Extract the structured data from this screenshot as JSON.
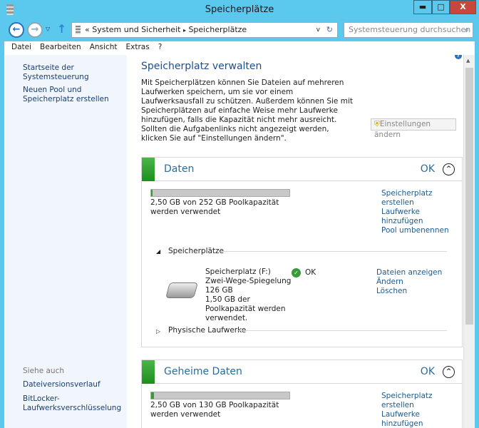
{
  "window": {
    "title": "Speicherplätze",
    "min": "▬",
    "max": "□",
    "close": "X"
  },
  "nav": {
    "back": "←",
    "forward": "→",
    "up": "↑",
    "breadcrumb_prefix": "«",
    "crumbs": [
      "System und Sicherheit",
      "Speicherplätze"
    ],
    "sep": "▸",
    "search_placeholder": "Systemsteuerung durchsuchen"
  },
  "menu": [
    "Datei",
    "Bearbeiten",
    "Ansicht",
    "Extras",
    "?"
  ],
  "sidebar": {
    "links": [
      "Startseite der Systemsteuerung",
      "Neuen Pool und Speicherplatz erstellen"
    ],
    "see_also": "Siehe auch",
    "see_links": [
      "Dateiversionsverlauf",
      "BitLocker-Laufwerksverschlüsselung"
    ]
  },
  "main": {
    "heading": "Speicherplatz verwalten",
    "intro": "Mit Speicherplätzen können Sie Dateien auf mehreren Laufwerken speichern, um sie vor einem Laufwerksausfall zu schützen. Außerdem können Sie mit Speicherplätzen auf einfache Weise mehr Laufwerke hinzufügen, falls die Kapazität nicht mehr ausreicht. Sollten die Aufgabenlinks nicht angezeigt werden, klicken Sie auf \"Einstellungen ändern\".",
    "settings_button": "Einstellungen ändern"
  },
  "pools": [
    {
      "name": "Daten",
      "status": "OK",
      "usage_text": "2,50 GB von 252 GB Poolkapazität werden verwendet",
      "usage_fraction": 0.01,
      "links": [
        "Speicherplatz erstellen",
        "Laufwerke hinzufügen",
        "Pool umbenennen"
      ],
      "spaces_label": "Speicherplätze",
      "space": {
        "name": "Speicherplatz (F:)",
        "type": "Zwei-Wege-Spiegelung",
        "size": "126 GB",
        "used": "1,50 GB der Poolkapazität werden verwendet.",
        "status": "OK",
        "links": [
          "Dateien anzeigen",
          "Ändern",
          "Löschen"
        ]
      },
      "physical_label": "Physische Laufwerke"
    },
    {
      "name": "Geheime Daten",
      "status": "OK",
      "usage_text": "2,50 GB von 130 GB Poolkapazität werden verwendet",
      "usage_fraction": 0.02,
      "links": [
        "Speicherplatz erstellen",
        "Laufwerke hinzufügen"
      ]
    }
  ]
}
